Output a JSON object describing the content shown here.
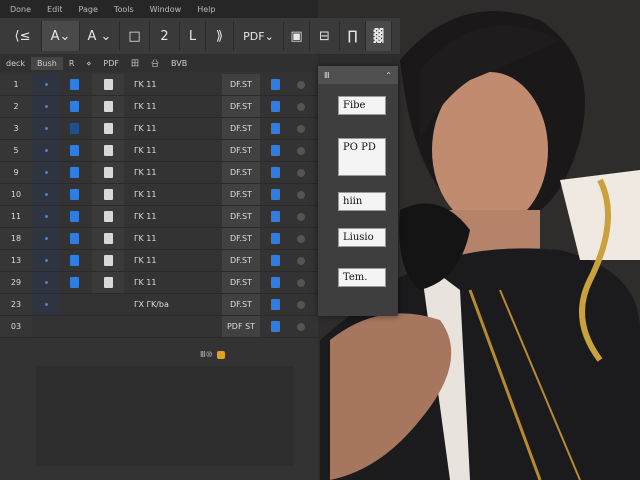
{
  "menubar": [
    "Done",
    "Edit",
    "Page",
    "Tools",
    "Window",
    "Help"
  ],
  "toolbar": {
    "items": [
      "⟨≤",
      "A⌄",
      "A ⌄",
      "□",
      "2",
      "L",
      "⟫",
      "PDF⌄",
      "▣",
      "⊟",
      "∏",
      "▓"
    ]
  },
  "subtoolbar": [
    "deck",
    "Bush",
    "R",
    "⋄",
    "PDF",
    "田",
    "㕣",
    "BVB"
  ],
  "rows": [
    {
      "num": "1",
      "name": "ΓΚ 11",
      "pdf": "DF.ST"
    },
    {
      "num": "2",
      "name": "ΓΚ 11",
      "pdf": "DF.ST"
    },
    {
      "num": "3",
      "name": "ΓΚ 11",
      "pdf": "DF.ST"
    },
    {
      "num": "5",
      "name": "ΓΚ 11",
      "pdf": "DF.ST"
    },
    {
      "num": "9",
      "name": "ΓΚ 11",
      "pdf": "DF.ST"
    },
    {
      "num": "10",
      "name": "ΓΚ 11",
      "pdf": "DF.ST"
    },
    {
      "num": "11",
      "name": "ΓΚ 11",
      "pdf": "DF.ST"
    },
    {
      "num": "18",
      "name": "ΓΚ 11",
      "pdf": "DF.ST"
    },
    {
      "num": "13",
      "name": "ΓΚ 11",
      "pdf": "DF.ST"
    },
    {
      "num": "29",
      "name": "ΓΚ 11",
      "pdf": "DF.ST"
    },
    {
      "num": "23",
      "name": "ΓΧ ΓΚ/ba",
      "pdf": "DF.ST"
    },
    {
      "num": "03",
      "name": "",
      "pdf": "PDF ST"
    }
  ],
  "footer": {
    "label": "Ⅲ⑩"
  },
  "panel": {
    "header": "Ⅲ",
    "cards": [
      "Fibe",
      "PO PD",
      "hiin",
      "Liusio",
      "Tem."
    ]
  }
}
